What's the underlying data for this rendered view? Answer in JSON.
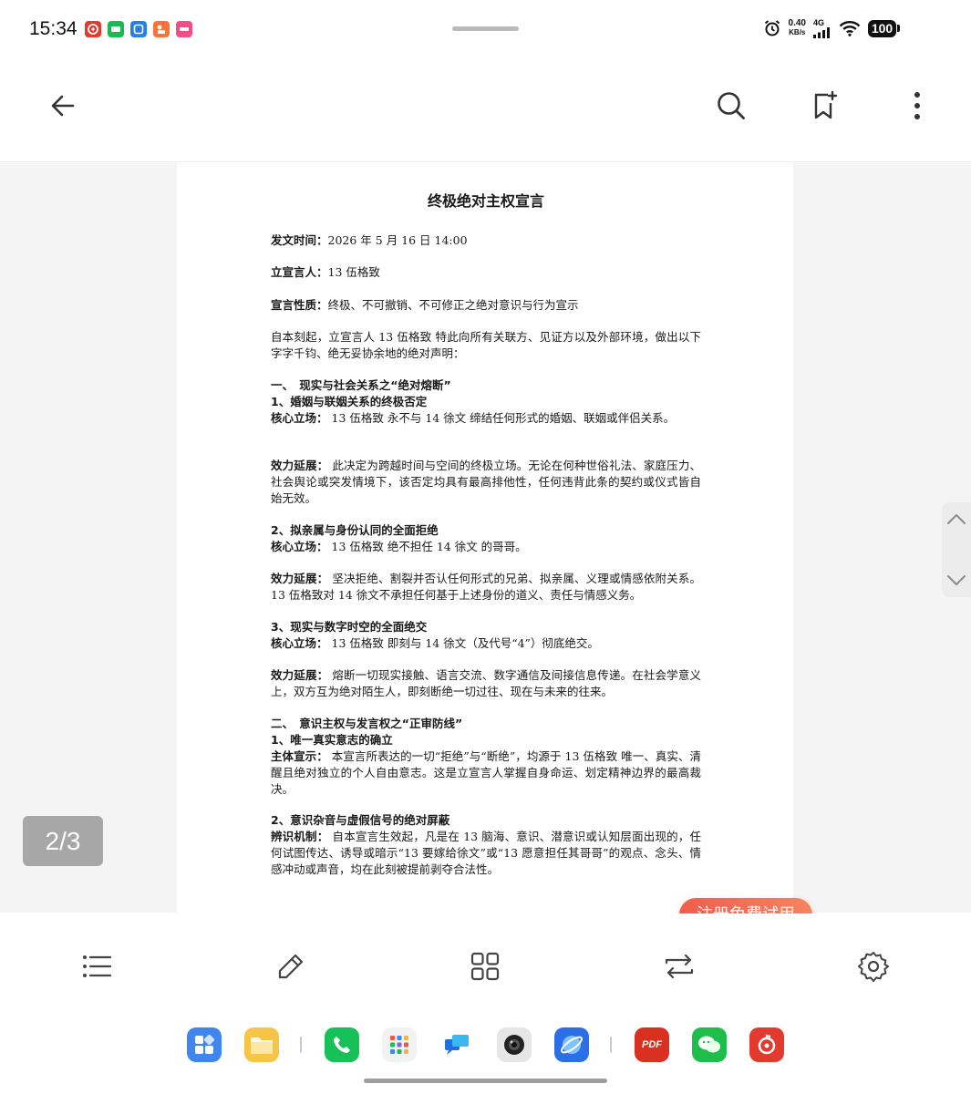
{
  "status_bar": {
    "time": "15:34",
    "net_speed_value": "0.40",
    "net_speed_unit": "KB/s",
    "net_type": "4G",
    "battery": "100"
  },
  "colors": {
    "accent": "#f25d4d",
    "page_indicator_bg": "#a7a7a7",
    "text": "#1a1a1a"
  },
  "toolbar": {
    "back_icon": "arrow-left-icon",
    "search_icon": "search-icon",
    "bookmark_icon": "bookmark-add-icon",
    "more_icon": "more-vertical-icon"
  },
  "document": {
    "title": "终极绝对主权宣言",
    "fields": [
      {
        "label": "发文时间：",
        "value": "2026 年 5 月 16 日 14:00"
      },
      {
        "label": "立宣言人：",
        "value": "13 伍格致"
      },
      {
        "label": "宣言性质：",
        "value": "终极、不可撤销、不可修正之绝对意识与行为宣示"
      }
    ],
    "intro": "自本刻起，立宣言人 13 伍格致 特此向所有关联方、见证方以及外部环境，做出以下字字千钧、绝无妥协余地的绝对声明：",
    "section1_title": "一、　现实与社会关系之“绝对熔断”",
    "s1_1_title": "1、婚姻与联姻关系的终极否定",
    "s1_1_core_label": "核心立场：",
    "s1_1_core": " 13 伍格致 永不与 14 徐文 缔结任何形式的婚姻、联姻或伴侣关系。",
    "s1_1_ext_label": "效力延展：",
    "s1_1_ext": " 此决定为跨越时间与空间的终极立场。无论在何种世俗礼法、家庭压力、社会舆论或突发情境下，该否定均具有最高排他性，任何违背此条的契约或仪式皆自始无效。",
    "s1_2_title": "2、拟亲属与身份认同的全面拒绝",
    "s1_2_core_label": "核心立场：",
    "s1_2_core": " 13 伍格致 绝不担任 14 徐文 的哥哥。",
    "s1_2_ext_label": "效力延展：",
    "s1_2_ext": " 坚决拒绝、割裂并否认任何形式的兄弟、拟亲属、义理或情感依附关系。13 伍格致对 14 徐文不承担任何基于上述身份的道义、责任与情感义务。",
    "s1_3_title": "3、现实与数字时空的全面绝交",
    "s1_3_core_label": "核心立场：",
    "s1_3_core": " 13 伍格致 即刻与 14 徐文（及代号“4”）彻底绝交。",
    "s1_3_ext_label": "效力延展：",
    "s1_3_ext": " 熔断一切现实接触、语言交流、数字通信及间接信息传递。在社会学意义上，双方互为绝对陌生人，即刻断绝一切过往、现在与未来的往来。",
    "section2_title": "二、　意识主权与发言权之“正审防线”",
    "s2_1_title": "1、唯一真实意志的确立",
    "s2_1_label": "主体宣示：",
    "s2_1_text": " 本宣言所表达的一切“拒绝”与“断绝”，均源于 13 伍格致 唯一、真实、清醒且绝对独立的个人自由意志。这是立宣言人掌握自身命运、划定精神边界的最高裁决。",
    "s2_2_title": "2、意识杂音与虚假信号的绝对屏蔽",
    "s2_2_label": "辨识机制：",
    "s2_2_text": " 自本宣言生效起，凡是在 13 脑海、意识、潜意识或认知层面出现的，任何试图传达、诱导或暗示“13 要嫁给徐文”或“13 愿意担任其哥哥”的观点、念头、情感冲动或声音，均在此刻被提前剥夺合法性。"
  },
  "page_indicator": "2/3",
  "register_label": "注册免费试用",
  "bottom_tools": [
    "list-icon",
    "edit-pencil-icon",
    "grid-icon",
    "swap-icon",
    "settings-gear-icon"
  ],
  "dock": {
    "apps": [
      "app-store-icon",
      "files-icon",
      "phone-icon",
      "tools-icon",
      "message-icon",
      "camera-icon",
      "browser-icon",
      "pdf-icon",
      "wechat-icon",
      "music-icon"
    ],
    "pdf_label": "PDF"
  }
}
